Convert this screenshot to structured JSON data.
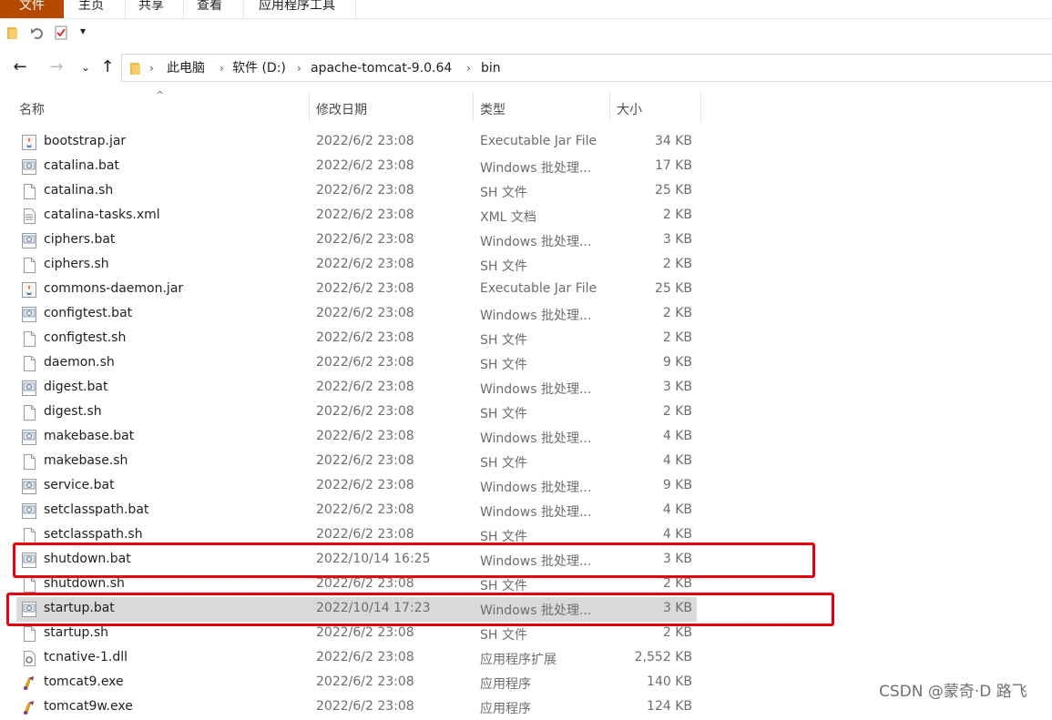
{
  "ribbon": {
    "tabs": [
      "文件",
      "主页",
      "共享",
      "查看",
      "应用程序工具"
    ]
  },
  "qat": {
    "dropdown": "▾"
  },
  "nav": {
    "back": "←",
    "forward": "→",
    "recent": "⌄",
    "up": "↑"
  },
  "address": {
    "crumbs": [
      "此电脑",
      "软件 (D:)",
      "apache-tomcat-9.0.64",
      "bin"
    ]
  },
  "columns": {
    "name": "名称",
    "date": "修改日期",
    "type": "类型",
    "size": "大小"
  },
  "files": [
    {
      "name": "bootstrap.jar",
      "date": "2022/6/2 23:08",
      "type": "Executable Jar File",
      "size": "34 KB",
      "icon": "jar-icon"
    },
    {
      "name": "catalina.bat",
      "date": "2022/6/2 23:08",
      "type": "Windows 批处理...",
      "size": "17 KB",
      "icon": "batch-icon"
    },
    {
      "name": "catalina.sh",
      "date": "2022/6/2 23:08",
      "type": "SH 文件",
      "size": "25 KB",
      "icon": "file-icon"
    },
    {
      "name": "catalina-tasks.xml",
      "date": "2022/6/2 23:08",
      "type": "XML 文档",
      "size": "2 KB",
      "icon": "xml-icon"
    },
    {
      "name": "ciphers.bat",
      "date": "2022/6/2 23:08",
      "type": "Windows 批处理...",
      "size": "3 KB",
      "icon": "batch-icon"
    },
    {
      "name": "ciphers.sh",
      "date": "2022/6/2 23:08",
      "type": "SH 文件",
      "size": "2 KB",
      "icon": "file-icon"
    },
    {
      "name": "commons-daemon.jar",
      "date": "2022/6/2 23:08",
      "type": "Executable Jar File",
      "size": "25 KB",
      "icon": "jar-icon"
    },
    {
      "name": "configtest.bat",
      "date": "2022/6/2 23:08",
      "type": "Windows 批处理...",
      "size": "2 KB",
      "icon": "batch-icon"
    },
    {
      "name": "configtest.sh",
      "date": "2022/6/2 23:08",
      "type": "SH 文件",
      "size": "2 KB",
      "icon": "file-icon"
    },
    {
      "name": "daemon.sh",
      "date": "2022/6/2 23:08",
      "type": "SH 文件",
      "size": "9 KB",
      "icon": "file-icon"
    },
    {
      "name": "digest.bat",
      "date": "2022/6/2 23:08",
      "type": "Windows 批处理...",
      "size": "3 KB",
      "icon": "batch-icon"
    },
    {
      "name": "digest.sh",
      "date": "2022/6/2 23:08",
      "type": "SH 文件",
      "size": "2 KB",
      "icon": "file-icon"
    },
    {
      "name": "makebase.bat",
      "date": "2022/6/2 23:08",
      "type": "Windows 批处理...",
      "size": "4 KB",
      "icon": "batch-icon"
    },
    {
      "name": "makebase.sh",
      "date": "2022/6/2 23:08",
      "type": "SH 文件",
      "size": "4 KB",
      "icon": "file-icon"
    },
    {
      "name": "service.bat",
      "date": "2022/6/2 23:08",
      "type": "Windows 批处理...",
      "size": "9 KB",
      "icon": "batch-icon"
    },
    {
      "name": "setclasspath.bat",
      "date": "2022/6/2 23:08",
      "type": "Windows 批处理...",
      "size": "4 KB",
      "icon": "batch-icon"
    },
    {
      "name": "setclasspath.sh",
      "date": "2022/6/2 23:08",
      "type": "SH 文件",
      "size": "4 KB",
      "icon": "file-icon"
    },
    {
      "name": "shutdown.bat",
      "date": "2022/10/14 16:25",
      "type": "Windows 批处理...",
      "size": "3 KB",
      "icon": "batch-icon",
      "highlighted": true
    },
    {
      "name": "shutdown.sh",
      "date": "2022/6/2 23:08",
      "type": "SH 文件",
      "size": "2 KB",
      "icon": "file-icon"
    },
    {
      "name": "startup.bat",
      "date": "2022/10/14 17:23",
      "type": "Windows 批处理...",
      "size": "3 KB",
      "icon": "batch-icon",
      "highlighted": true,
      "selected": true
    },
    {
      "name": "startup.sh",
      "date": "2022/6/2 23:08",
      "type": "SH 文件",
      "size": "2 KB",
      "icon": "file-icon"
    },
    {
      "name": "tcnative-1.dll",
      "date": "2022/6/2 23:08",
      "type": "应用程序扩展",
      "size": "2,552 KB",
      "icon": "dll-icon"
    },
    {
      "name": "tomcat9.exe",
      "date": "2022/6/2 23:08",
      "type": "应用程序",
      "size": "140 KB",
      "icon": "exe-icon"
    },
    {
      "name": "tomcat9w.exe",
      "date": "2022/6/2 23:08",
      "type": "应用程序",
      "size": "124 KB",
      "icon": "exe-icon"
    }
  ],
  "colors": {
    "file_tab": "#b44a00",
    "highlight": "#e8000f",
    "selected_row": "#d9d9d9"
  },
  "watermark": "CSDN @蒙奇·D 路飞"
}
